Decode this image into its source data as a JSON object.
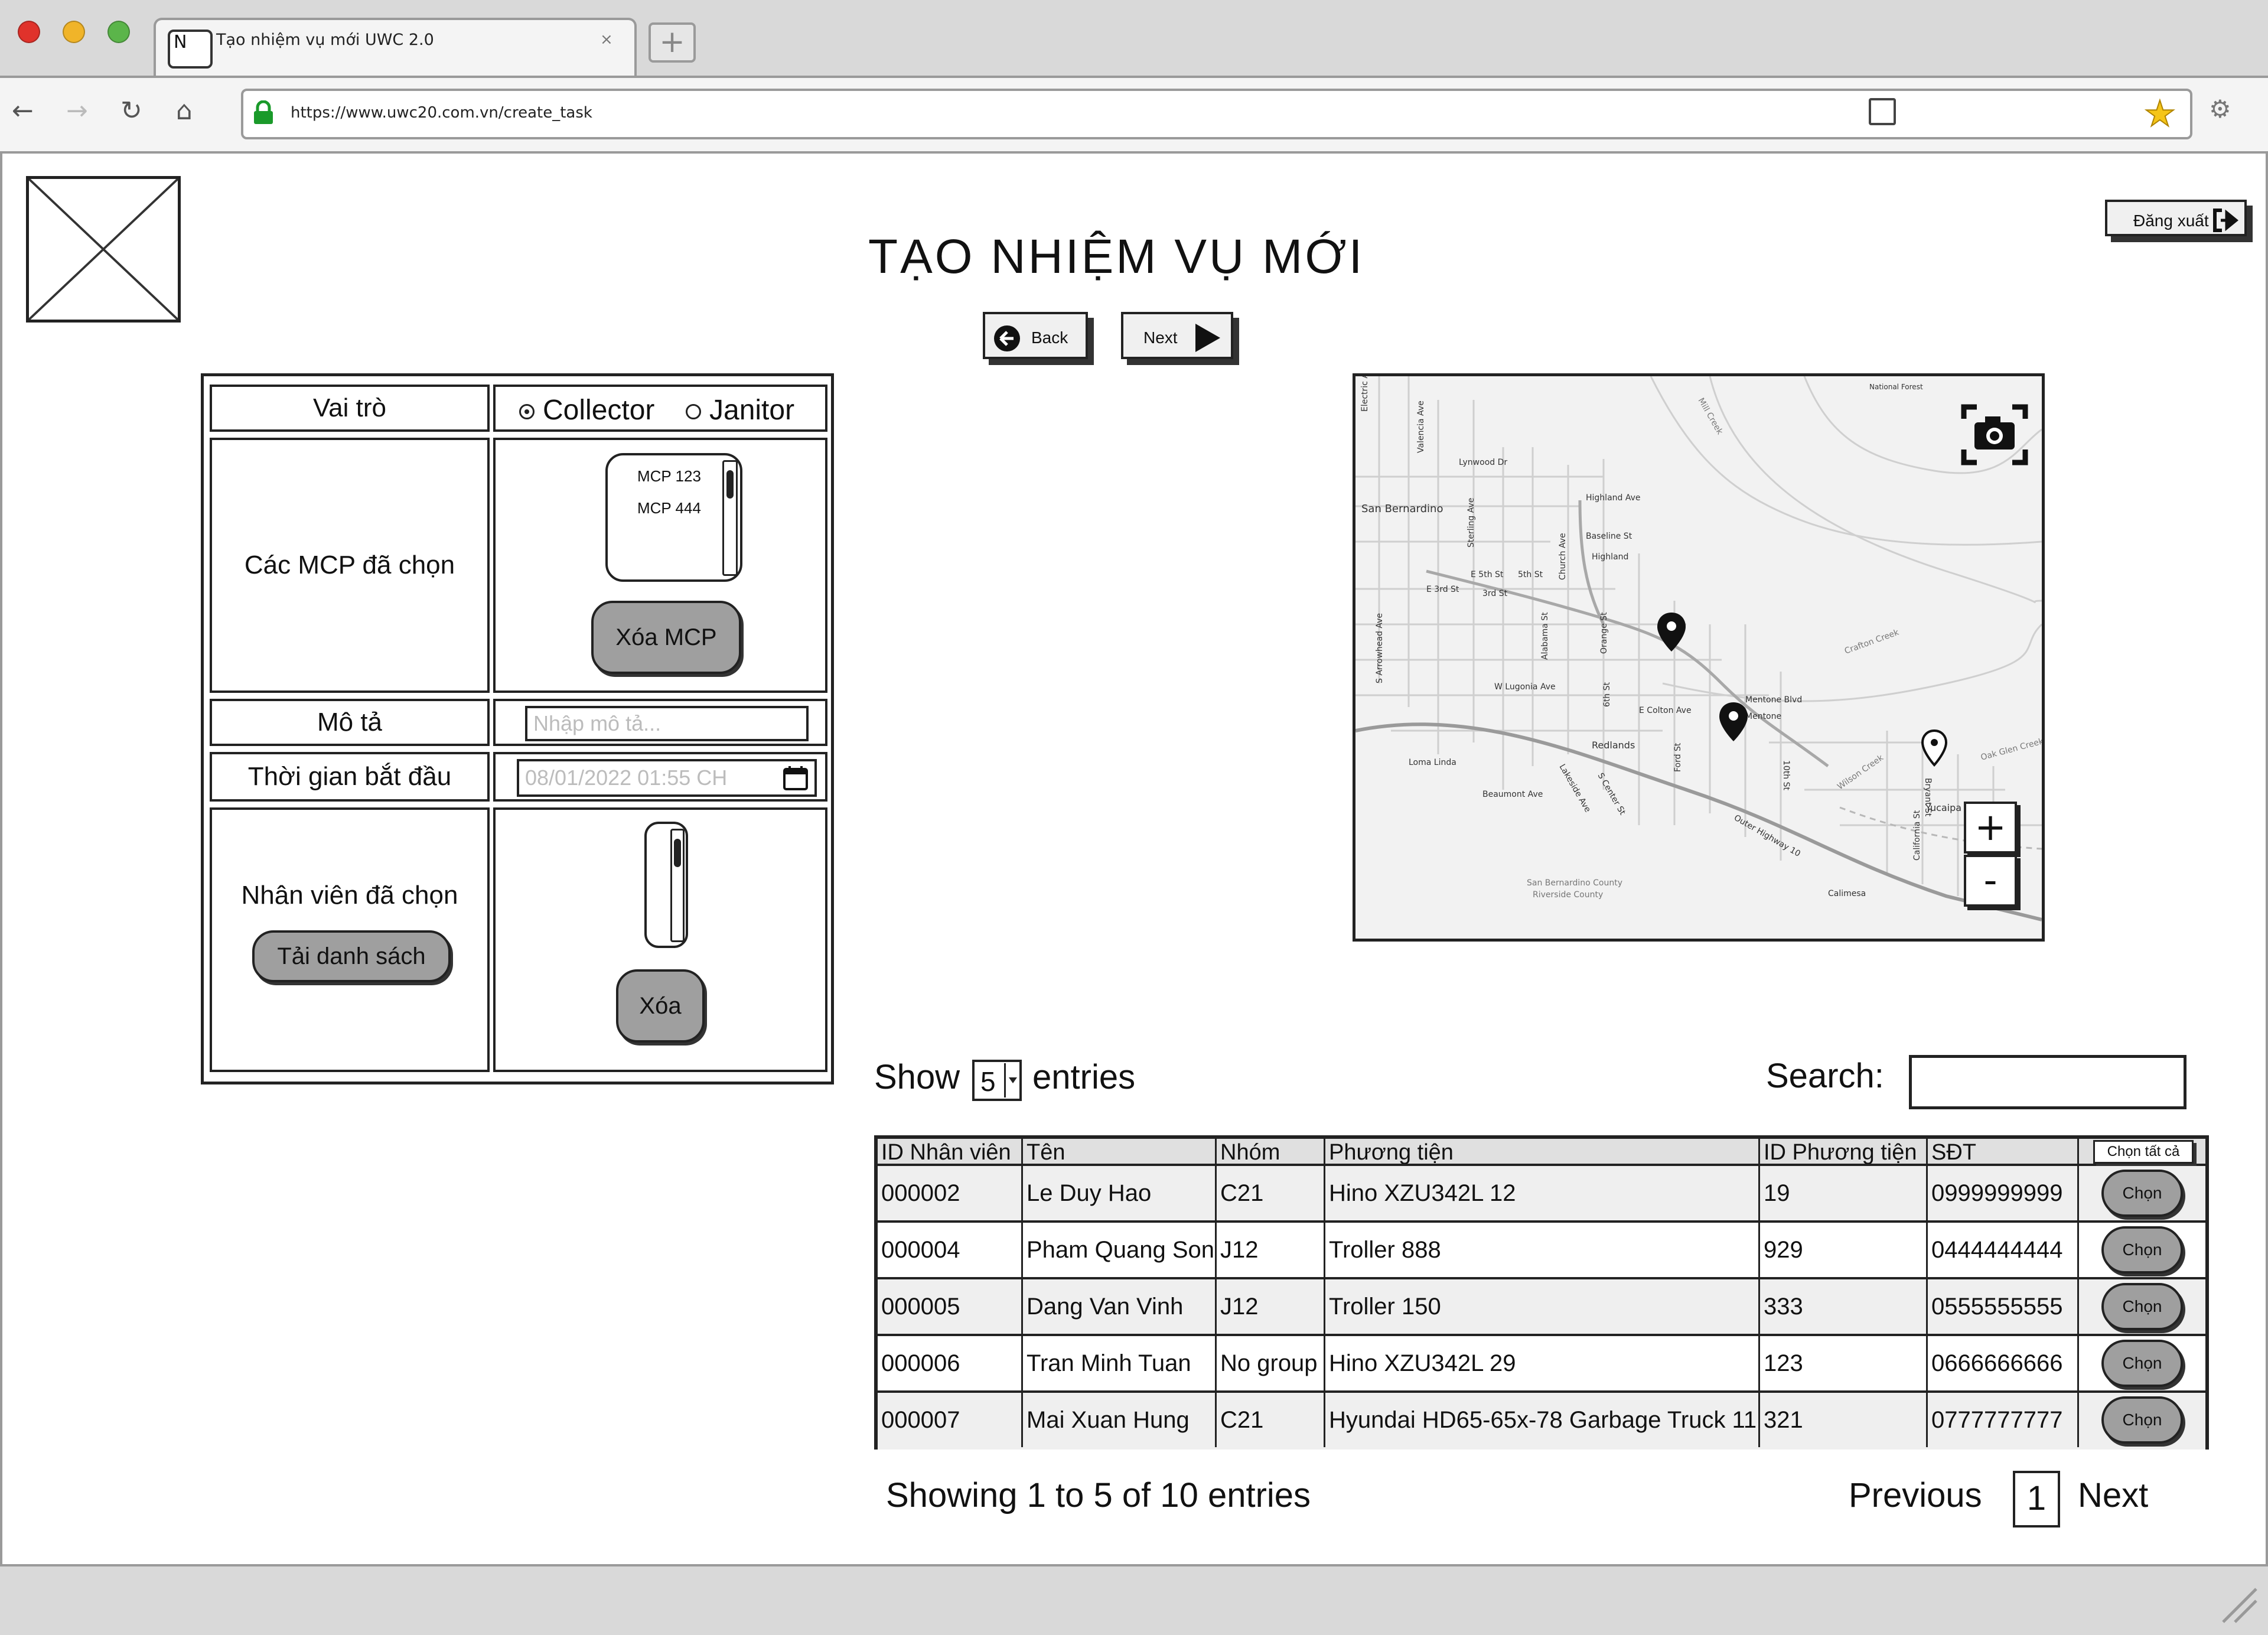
{
  "browser": {
    "tab_title": "Tạo nhiệm vụ mới UWC 2.0",
    "tab_close": "×",
    "favicon_letter": "N",
    "new_tab": "+",
    "url": "https://www.uwc20.com.vn/create_task",
    "nav_icons": [
      "back-arrow-icon",
      "forward-arrow-icon",
      "reload-icon",
      "home-icon"
    ],
    "nav_glyphs": [
      "←",
      "→",
      "↻",
      "⌂"
    ],
    "star_glyph": "★",
    "gear_glyph": "⚙"
  },
  "header": {
    "title": "TẠO NHIỆM VỤ MỚI",
    "logout_label": "Đăng xuất",
    "back_label": "Back",
    "next_label": "Next"
  },
  "form": {
    "role_label": "Vai trò",
    "role_options": [
      "Collector",
      "Janitor"
    ],
    "role_selected": "Collector",
    "mcp_label": "Các MCP đã chọn",
    "mcp_items": [
      "MCP 123",
      "MCP 444"
    ],
    "mcp_delete": "Xóa MCP",
    "desc_label": "Mô tả",
    "desc_placeholder": "Nhập mô tả...",
    "start_label": "Thời gian bắt đầu",
    "start_value": "08/01/2022 01:55 CH",
    "staff_label": "Nhân viên đã chọn",
    "load_list": "Tải danh sách",
    "staff_delete": "Xóa"
  },
  "map": {
    "labels": [
      "Electric Ave",
      "Valencia Ave",
      "Lynwood Dr",
      "San Bernardino",
      "Highland Ave",
      "Baseline St",
      "Highland",
      "E 5th St",
      "5th St",
      "E 3rd St",
      "3rd St",
      "Alabama St",
      "Orange St",
      "S Arrowhead Ave",
      "W Lugonia Ave",
      "6th St",
      "E Colton Ave",
      "Mentone Blvd",
      "Mentone",
      "Redlands",
      "Loma Linda",
      "Beaumont Ave",
      "Lakeside Ave",
      "S Center St",
      "Ford St",
      "10th St",
      "Outer Highway 10",
      "Yucaipa",
      "California St",
      "Bryant St",
      "Calimesa",
      "San Bernardino County",
      "Riverside County",
      "National Forest",
      "Oak Glen Creek",
      "Wilson Creek",
      "Crafton Creek",
      "Mill Creek",
      "Church Ave",
      "Sterling Ave"
    ],
    "zoom_in": "+",
    "zoom_out": "-"
  },
  "table": {
    "show_label": "Show",
    "entries_label": "entries",
    "page_size": "5",
    "search_label": "Search:",
    "columns": [
      "ID Nhân viên",
      "Tên",
      "Nhóm",
      "Phương tiện",
      "ID Phương tiện",
      "SĐT"
    ],
    "select_all": "Chọn tất cả",
    "choose_label": "Chọn",
    "rows": [
      [
        "000002",
        "Le Duy Hao",
        "C21",
        "Hino XZU342L 12",
        "19",
        "0999999999"
      ],
      [
        "000004",
        "Pham Quang Son",
        "J12",
        "Troller 888",
        "929",
        "0444444444"
      ],
      [
        "000005",
        "Dang Van Vinh",
        "J12",
        "Troller 150",
        "333",
        "0555555555"
      ],
      [
        "000006",
        "Tran Minh Tuan",
        "No group",
        "Hino XZU342L 29",
        "123",
        "0666666666"
      ],
      [
        "000007",
        "Mai Xuan Hung",
        "C21",
        "Hyundai HD65-65x-78 Garbage Truck 11",
        "321",
        "0777777777"
      ]
    ],
    "info": "Showing 1 to 5 of 10 entries",
    "prev_label": "Previous",
    "page": "1",
    "next_label": "Next"
  }
}
